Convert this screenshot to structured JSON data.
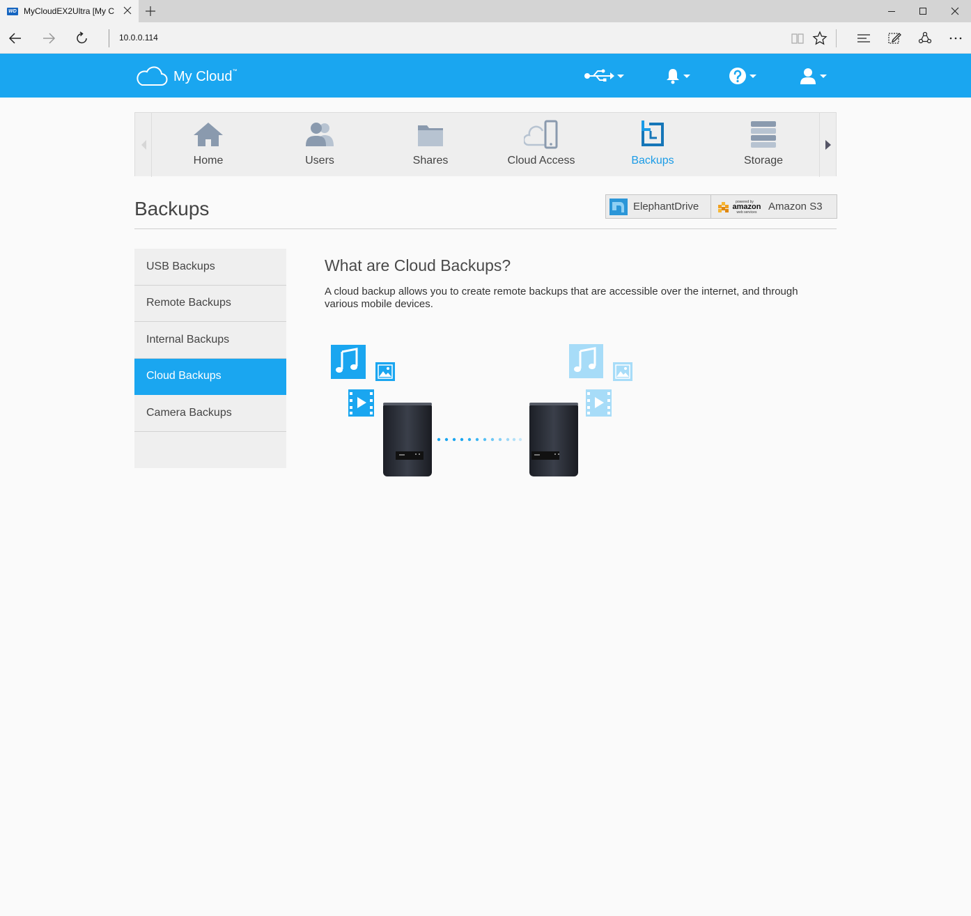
{
  "browser": {
    "tab_title": "MyCloudEX2Ultra [My C",
    "favicon_text": "WD",
    "address": "10.0.0.114"
  },
  "app": {
    "logo_text": "My Cloud",
    "logo_tm": "™",
    "accent_color": "#1aa6f0"
  },
  "nav": {
    "items": [
      {
        "label": "Home",
        "icon": "home-icon"
      },
      {
        "label": "Users",
        "icon": "users-icon"
      },
      {
        "label": "Shares",
        "icon": "folder-icon"
      },
      {
        "label": "Cloud Access",
        "icon": "cloud-device-icon"
      },
      {
        "label": "Backups",
        "icon": "backup-icon",
        "active": true
      },
      {
        "label": "Storage",
        "icon": "storage-icon"
      }
    ]
  },
  "page": {
    "title": "Backups",
    "providers": [
      {
        "label": "ElephantDrive",
        "icon": "elephantdrive-logo-icon"
      },
      {
        "label": "Amazon S3",
        "icon": "aws-logo-icon",
        "logo_top": "powered by",
        "logo_main": "amazon",
        "logo_bottom": "web services"
      }
    ]
  },
  "sidebar": {
    "items": [
      {
        "label": "USB Backups"
      },
      {
        "label": "Remote Backups"
      },
      {
        "label": "Internal Backups"
      },
      {
        "label": "Cloud Backups",
        "active": true
      },
      {
        "label": "Camera Backups"
      }
    ]
  },
  "content": {
    "title": "What are Cloud Backups?",
    "description": "A cloud backup allows you to create remote backups that are accessible over the internet, and through various mobile devices."
  }
}
